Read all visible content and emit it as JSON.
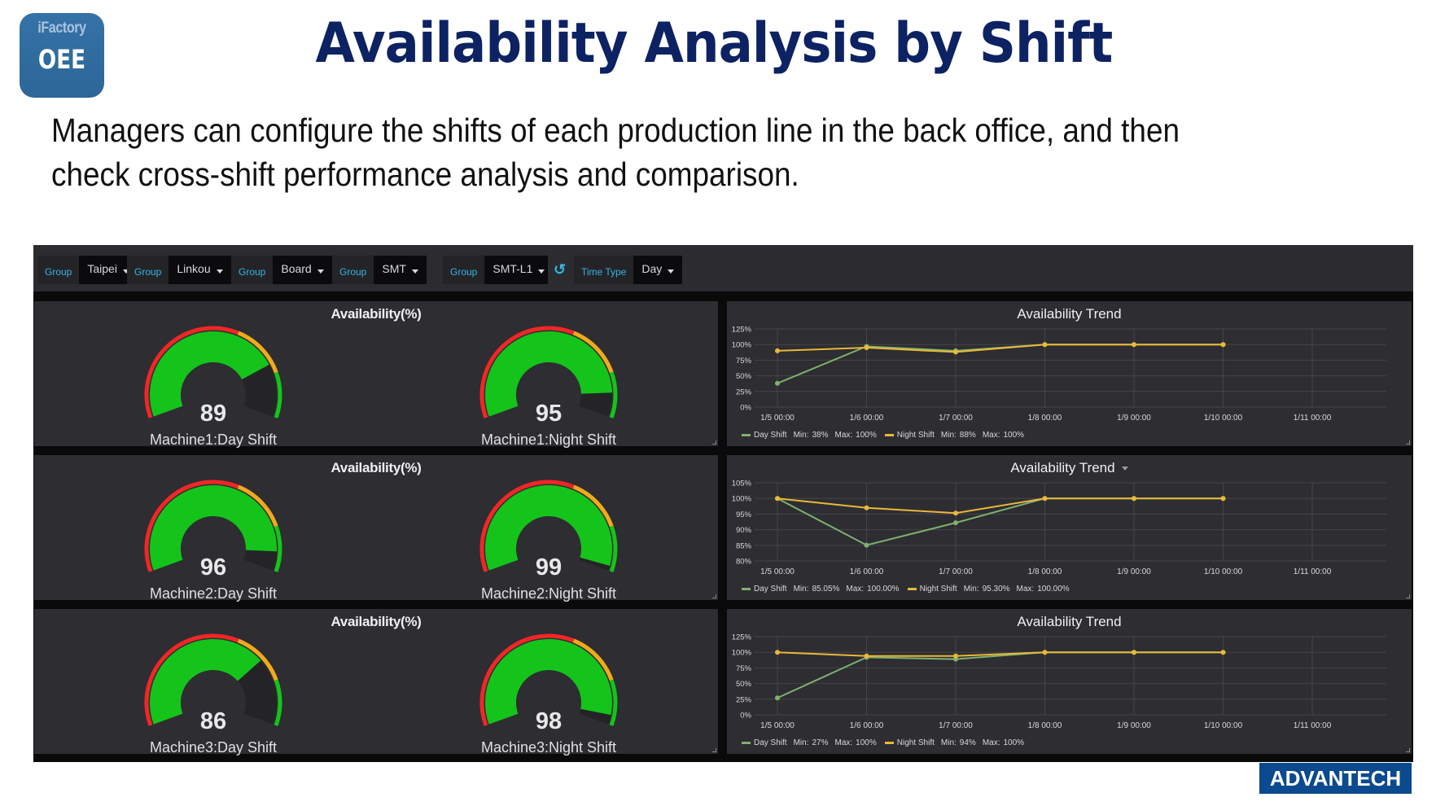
{
  "header": {
    "logo_top": "iFactory",
    "logo_bottom": "OEE",
    "title": "Availability Analysis by Shift",
    "subtitle_line1": "Managers can configure the shifts of each production line in the back office, and then",
    "subtitle_line2": "check cross-shift performance analysis and comparison."
  },
  "toolbar": {
    "filters": [
      {
        "label": "Group",
        "value": "Taipei"
      },
      {
        "label": "Group",
        "value": "Linkou"
      },
      {
        "label": "Group",
        "value": "Board"
      },
      {
        "label": "Group",
        "value": "SMT"
      },
      {
        "label": "Group",
        "value": "SMT-L1"
      }
    ],
    "refresh_icon": "refresh-icon",
    "time_type": {
      "label": "Time Type",
      "value": "Day"
    }
  },
  "colors": {
    "accent": "#33b5e5",
    "gauge_fill": "#15c41a",
    "gauge_red": "#f22626",
    "gauge_orange": "#f2a91a",
    "gauge_green": "#15c41a",
    "day_shift": "#7eb26d",
    "night_shift": "#eab839",
    "panel_bg": "#2d2d32",
    "logo_bg": "#0c4a8f",
    "title": "#0d2263"
  },
  "gauge_panels": [
    {
      "title": "Availability(%)",
      "gauges": [
        {
          "value": 89,
          "label": "Machine1:Day Shift"
        },
        {
          "value": 95,
          "label": "Machine1:Night Shift"
        }
      ]
    },
    {
      "title": "Availability(%)",
      "gauges": [
        {
          "value": 96,
          "label": "Machine2:Day Shift"
        },
        {
          "value": 99,
          "label": "Machine2:Night Shift"
        }
      ]
    },
    {
      "title": "Availability(%)",
      "gauges": [
        {
          "value": 86,
          "label": "Machine3:Day Shift"
        },
        {
          "value": 98,
          "label": "Machine3:Night Shift"
        }
      ]
    }
  ],
  "gauge_scale": {
    "min": 50,
    "max": 100,
    "thresholds": [
      80,
      91
    ]
  },
  "chart_data": [
    {
      "type": "line",
      "title": "Availability Trend",
      "has_menu": false,
      "x": [
        "1/5 00:00",
        "1/6 00:00",
        "1/7 00:00",
        "1/8 00:00",
        "1/9 00:00",
        "1/10 00:00",
        "1/11 00:00"
      ],
      "yticks": [
        "0%",
        "25%",
        "50%",
        "75%",
        "100%",
        "125%"
      ],
      "ylim": [
        0,
        125
      ],
      "grid": true,
      "legend_position": "bottom-left",
      "series": [
        {
          "name": "Day Shift",
          "values": [
            38,
            97,
            90,
            100,
            100,
            100
          ],
          "min": "38%",
          "max": "100%"
        },
        {
          "name": "Night Shift",
          "values": [
            90,
            95,
            88,
            100,
            100,
            100
          ],
          "min": "88%",
          "max": "100%"
        }
      ]
    },
    {
      "type": "line",
      "title": "Availability Trend",
      "has_menu": true,
      "x": [
        "1/5 00:00",
        "1/6 00:00",
        "1/7 00:00",
        "1/8 00:00",
        "1/9 00:00",
        "1/10 00:00",
        "1/11 00:00"
      ],
      "yticks": [
        "80%",
        "85%",
        "90%",
        "95%",
        "100%",
        "105%"
      ],
      "ylim": [
        80,
        105
      ],
      "grid": true,
      "legend_position": "bottom-left",
      "series": [
        {
          "name": "Day Shift",
          "values": [
            100,
            85.05,
            92.2,
            100,
            100,
            100
          ],
          "min": "85.05%",
          "max": "100.00%"
        },
        {
          "name": "Night Shift",
          "values": [
            100,
            97,
            95.3,
            100,
            100,
            100
          ],
          "min": "95.30%",
          "max": "100.00%"
        }
      ]
    },
    {
      "type": "line",
      "title": "Availability Trend",
      "has_menu": false,
      "x": [
        "1/5 00:00",
        "1/6 00:00",
        "1/7 00:00",
        "1/8 00:00",
        "1/9 00:00",
        "1/10 00:00",
        "1/11 00:00"
      ],
      "yticks": [
        "0%",
        "25%",
        "50%",
        "75%",
        "100%",
        "125%"
      ],
      "ylim": [
        0,
        125
      ],
      "grid": true,
      "legend_position": "bottom-left",
      "series": [
        {
          "name": "Day Shift",
          "values": [
            27,
            92,
            89,
            100,
            100,
            100
          ],
          "min": "27%",
          "max": "100%"
        },
        {
          "name": "Night Shift",
          "values": [
            100,
            94,
            94,
            100,
            100,
            100
          ],
          "min": "94%",
          "max": "100%"
        }
      ]
    }
  ],
  "legend_labels": {
    "min": "Min:",
    "max": "Max:"
  },
  "footer": {
    "brand": "ADVANTECH"
  }
}
